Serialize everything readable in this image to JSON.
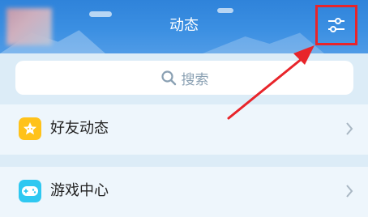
{
  "header": {
    "title": "动态",
    "filter_icon": "sliders-icon"
  },
  "search": {
    "placeholder": "搜索",
    "icon": "search-icon"
  },
  "list": [
    {
      "label": "好友动态",
      "icon": "star-icon",
      "icon_color": "#ffc21a"
    },
    {
      "label": "游戏中心",
      "icon": "gamepad-icon",
      "icon_color": "#2fc8f1"
    }
  ],
  "colors": {
    "header_blue": "#3b8fe2",
    "highlight_red": "#e8242a",
    "background": "#dcecf7"
  }
}
